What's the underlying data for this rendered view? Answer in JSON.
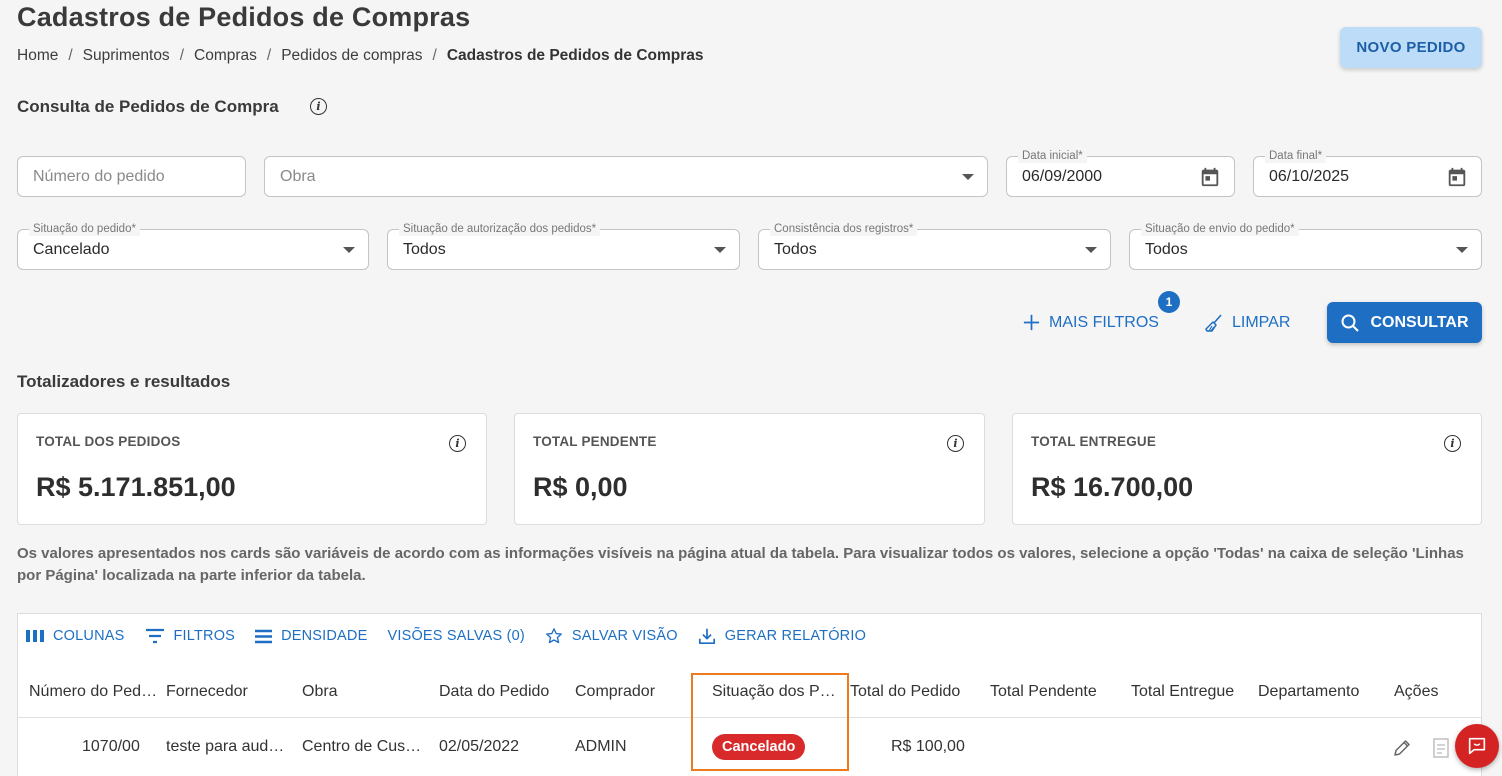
{
  "header": {
    "title": "Cadastros de Pedidos de Compras",
    "breadcrumb": [
      "Home",
      "Suprimentos",
      "Compras",
      "Pedidos de compras",
      "Cadastros de Pedidos de Compras"
    ],
    "new_button": "NOVO PEDIDO"
  },
  "filters": {
    "section_title": "Consulta de Pedidos de Compra",
    "order_number_placeholder": "Número do pedido",
    "obra_placeholder": "Obra",
    "start_date_label": "Data inicial*",
    "start_date_value": "06/09/2000",
    "end_date_label": "Data final*",
    "end_date_value": "06/10/2025",
    "status_label": "Situação do pedido*",
    "status_value": "Cancelado",
    "auth_label": "Situação de autorização dos pedidos*",
    "auth_value": "Todos",
    "consistency_label": "Consistência dos registros*",
    "consistency_value": "Todos",
    "send_label": "Situação de envio do pedido*",
    "send_value": "Todos",
    "more_filters": "MAIS FILTROS",
    "more_filters_count": "1",
    "clear": "LIMPAR",
    "search": "CONSULTAR"
  },
  "totals": {
    "section_title": "Totalizadores e resultados",
    "cards": [
      {
        "label": "TOTAL DOS PEDIDOS",
        "value": "R$ 5.171.851,00"
      },
      {
        "label": "TOTAL PENDENTE",
        "value": "R$ 0,00"
      },
      {
        "label": "TOTAL ENTREGUE",
        "value": "R$ 16.700,00"
      }
    ],
    "note": "Os valores apresentados nos cards são variáveis de acordo com as informações visíveis na página atual da tabela. Para visualizar todos os valores, selecione a opção 'Todas' na caixa de seleção 'Linhas por Página' localizada na parte inferior da tabela."
  },
  "table": {
    "toolbar": {
      "columns": "COLUNAS",
      "filters": "FILTROS",
      "density": "DENSIDADE",
      "saved_views": "VISÕES SALVAS (0)",
      "save_view": "SALVAR VISÃO",
      "report": "GERAR RELATÓRIO"
    },
    "headers": [
      "Número do Ped…",
      "Fornecedor",
      "Obra",
      "Data do Pedido",
      "Comprador",
      "Situação dos P…",
      "Total do Pedido",
      "Total Pendente",
      "Total Entregue",
      "Departamento",
      "Ações"
    ],
    "rows": [
      {
        "number": "1070/00",
        "supplier": "teste para aud…",
        "obra": "Centro de Cus…",
        "date": "02/05/2022",
        "buyer": "ADMIN",
        "status": "Cancelado",
        "total": "R$ 100,00",
        "pending": "",
        "delivered": "",
        "department": ""
      }
    ]
  },
  "colors": {
    "accent": "#1e6fc4",
    "status_cancelled": "#d82a2a",
    "highlight": "#ee7a1f"
  }
}
